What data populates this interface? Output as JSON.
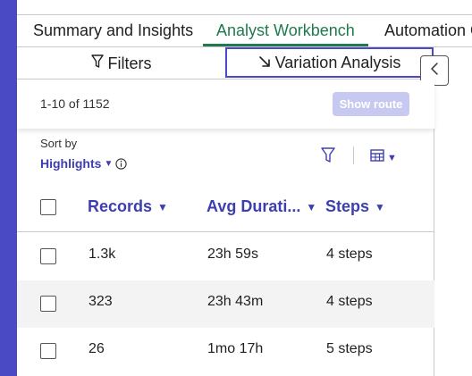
{
  "tabs": [
    {
      "label": "Summary and Insights"
    },
    {
      "label": "Analyst Workbench"
    },
    {
      "label": "Automation Op"
    }
  ],
  "subtabs": {
    "filters_label": "Filters",
    "variation_label": "Variation Analysis"
  },
  "pager": {
    "range_text": "1-10 of 1152",
    "show_route_label": "Show route"
  },
  "sort": {
    "label": "Sort by",
    "value": "Highlights"
  },
  "table": {
    "columns": [
      {
        "label": "Records"
      },
      {
        "label": "Avg Durati..."
      },
      {
        "label": "Steps"
      }
    ],
    "rows": [
      {
        "records": "1.3k",
        "duration": "23h 59s",
        "steps": "4 steps"
      },
      {
        "records": "323",
        "duration": "23h 43m",
        "steps": "4 steps"
      },
      {
        "records": "26",
        "duration": "1mo 17h",
        "steps": "5 steps"
      }
    ]
  },
  "colors": {
    "accent": "#4a4bc4",
    "link": "#3d3fb0",
    "active_tab": "#1f7a4c",
    "disabled_button": "#c8c9f0"
  },
  "icons": {
    "filter": "filter-funnel-icon",
    "variation": "arrow-down-right-icon",
    "collapse": "chevron-left-icon",
    "info": "info-circle-icon",
    "columns": "table-columns-icon"
  }
}
